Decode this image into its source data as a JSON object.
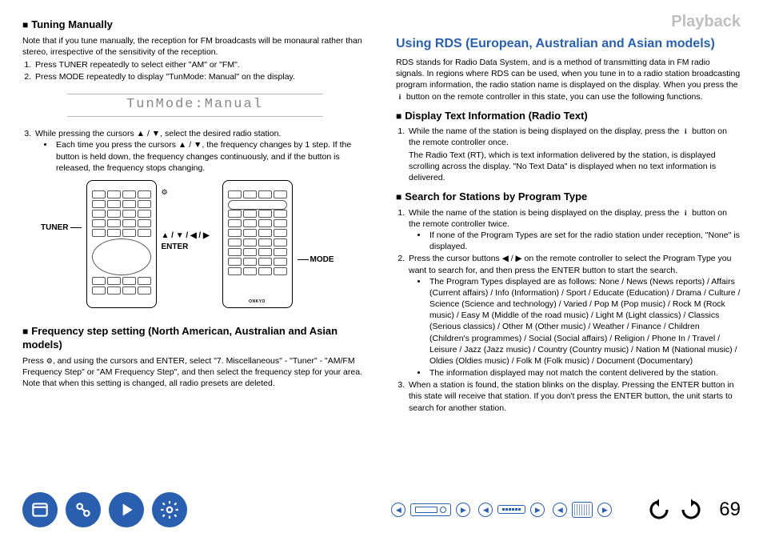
{
  "breadcrumb": "Playback",
  "page_number": "69",
  "left": {
    "h_tuning": "Tuning Manually",
    "tuning_note": "Note that if you tune manually, the reception for FM broadcasts will be monaural rather than stereo, irrespective of the sensitivity of the reception.",
    "tuning_steps": [
      "Press TUNER repeatedly to select either \"AM\" or \"FM\".",
      "Press MODE repeatedly to display \"TunMode: Manual\" on the display."
    ],
    "lcd_text": "TunMode:Manual",
    "tuning_step3_lead": "While pressing the cursors ▲ / ▼, select the desired radio station.",
    "tuning_step3_bullet": "Each time you press the cursors ▲ / ▼, the frequency changes by 1 step. If the button is held down, the frequency changes continuously, and if the button is released, the frequency stops changing.",
    "callout_tuner": "TUNER",
    "callout_arrows": "▲ / ▼ / ◀ / ▶",
    "callout_enter": "ENTER",
    "callout_mode": "MODE",
    "remote_brand": "ONKYO",
    "h_freq": "Frequency step setting (North American, Australian and Asian models)",
    "freq_body_a": "Press ",
    "freq_body_b": ", and using the cursors and ENTER, select \"7. Miscellaneous\" - \"Tuner\" - \"AM/FM Frequency Step\" or \"AM Frequency Step\", and then select the frequency step for your area. Note that when this setting is changed, all radio presets are deleted."
  },
  "right": {
    "h_rds": "Using RDS (European, Australian and Asian models)",
    "rds_body_a": "RDS stands for Radio Data System, and is a method of transmitting data in FM radio signals. In regions where RDS can be used, when you tune in to a radio station broadcasting program information, the radio station name is displayed on the display. When you press the ",
    "rds_body_b": " button on the remote controller in this state, you can use the following functions.",
    "h_radiotext": "Display Text Information (Radio Text)",
    "rt_step1_a": "While the name of the station is being displayed on the display, press the ",
    "rt_step1_b": " button on the remote controller once.",
    "rt_step1_body": "The Radio Text (RT), which is text information delivered by the station, is displayed scrolling across the display. \"No Text Data\" is displayed when no text information is delivered.",
    "h_search": "Search for Stations by Program Type",
    "sr_step1_a": "While the name of the station is being displayed on the display, press the ",
    "sr_step1_b": " button on the remote controller twice.",
    "sr_step1_bullet": "If none of the Program Types are set for the radio station under reception, \"None\" is displayed.",
    "sr_step2": "Press the cursor buttons ◀ / ▶ on the remote controller to select the Program Type you want to search for, and then press the ENTER button to start the search.",
    "sr_step2_bullet1": "The Program Types displayed are as follows: None / News (News reports) / Affairs (Current affairs) / Info (Information) / Sport / Educate (Education) / Drama / Culture / Science (Science and technology) / Varied / Pop M (Pop music) / Rock M (Rock music) / Easy M (Middle of the road music) / Light M (Light classics) / Classics (Serious classics) / Other M (Other music) / Weather / Finance / Children (Children's programmes) / Social (Social affairs) / Religion / Phone In / Travel / Leisure / Jazz (Jazz music) / Country (Country music) / Nation M (National music) / Oldies (Oldies music) / Folk M (Folk music) / Document (Documentary)",
    "sr_step2_bullet2": "The information displayed may not match the content delivered by the station.",
    "sr_step3": "When a station is found, the station blinks on the display. Pressing the ENTER button in this state will receive that station. If you don't press the ENTER button, the unit starts to search for another station."
  },
  "footer_icons": {
    "book": "book-icon",
    "cables": "cables-icon",
    "play": "play-icon",
    "gear": "gear-icon",
    "front": "front-panel",
    "rear": "rear-panel",
    "remote": "remote-icon",
    "back": "back-arrow",
    "fwd": "forward-arrow"
  }
}
